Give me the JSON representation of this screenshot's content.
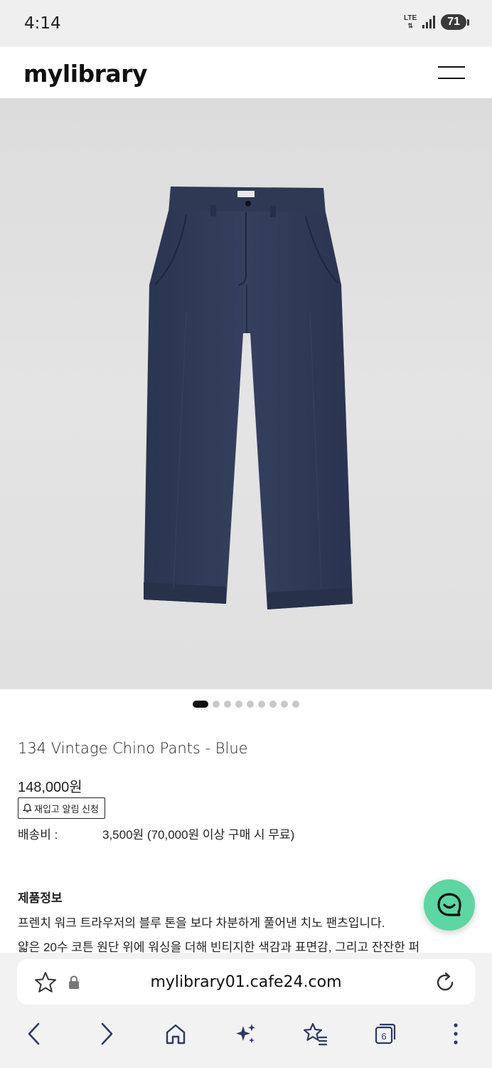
{
  "status_bar": {
    "time": "4:14",
    "network": "LTE",
    "battery": "71"
  },
  "site": {
    "logo": "mylibrary"
  },
  "carousel": {
    "total": 9,
    "active": 0
  },
  "product": {
    "name": "134 Vintage Chino Pants - Blue",
    "price": "148,000원",
    "restock_button": "재입고 알림 신청",
    "shipping_label": "배송비 :",
    "shipping_value": "3,500원 (70,000원 이상 구매 시 무료)",
    "info_heading": "제품정보",
    "info_lines": [
      "프렌치 워크 트라우저의 블루 톤을 보다 차분하게 풀어낸 치노 팬츠입니다.",
      "얇은 20수 코튼 원단 위에 워싱을 더해 빈티지한 색감과 표면감, 그리고 잔잔한 퍼"
    ]
  },
  "browser": {
    "url": "mylibrary01.cafe24.com",
    "tab_count": "6"
  },
  "colors": {
    "pants": "#2f3a55",
    "chat_button": "#5cd6a2",
    "background_grey": "#e0e0e0"
  }
}
